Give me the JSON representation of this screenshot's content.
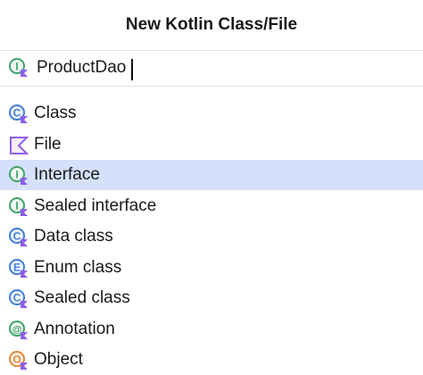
{
  "dialog": {
    "title": "New Kotlin Class/File",
    "name_field": {
      "value": "ProductDao",
      "icon": "kotlin-interface-icon"
    },
    "kinds": [
      {
        "label": "Class",
        "icon": "kotlin-class-icon",
        "selected": false
      },
      {
        "label": "File",
        "icon": "kotlin-file-icon",
        "selected": false
      },
      {
        "label": "Interface",
        "icon": "kotlin-interface-icon",
        "selected": true
      },
      {
        "label": "Sealed interface",
        "icon": "kotlin-interface-icon",
        "selected": false
      },
      {
        "label": "Data class",
        "icon": "kotlin-class-icon",
        "selected": false
      },
      {
        "label": "Enum class",
        "icon": "kotlin-enum-icon",
        "selected": false
      },
      {
        "label": "Sealed class",
        "icon": "kotlin-class-icon",
        "selected": false
      },
      {
        "label": "Annotation",
        "icon": "kotlin-annotation-icon",
        "selected": false
      },
      {
        "label": "Object",
        "icon": "kotlin-object-icon",
        "selected": false
      }
    ]
  },
  "colors": {
    "class_ring": "#3f7fd8",
    "interface_ring": "#3fa36a",
    "enum_ring": "#3f7fd8",
    "kotlin_mark": "#8f5ee8",
    "selection": "#d5e1fb"
  }
}
